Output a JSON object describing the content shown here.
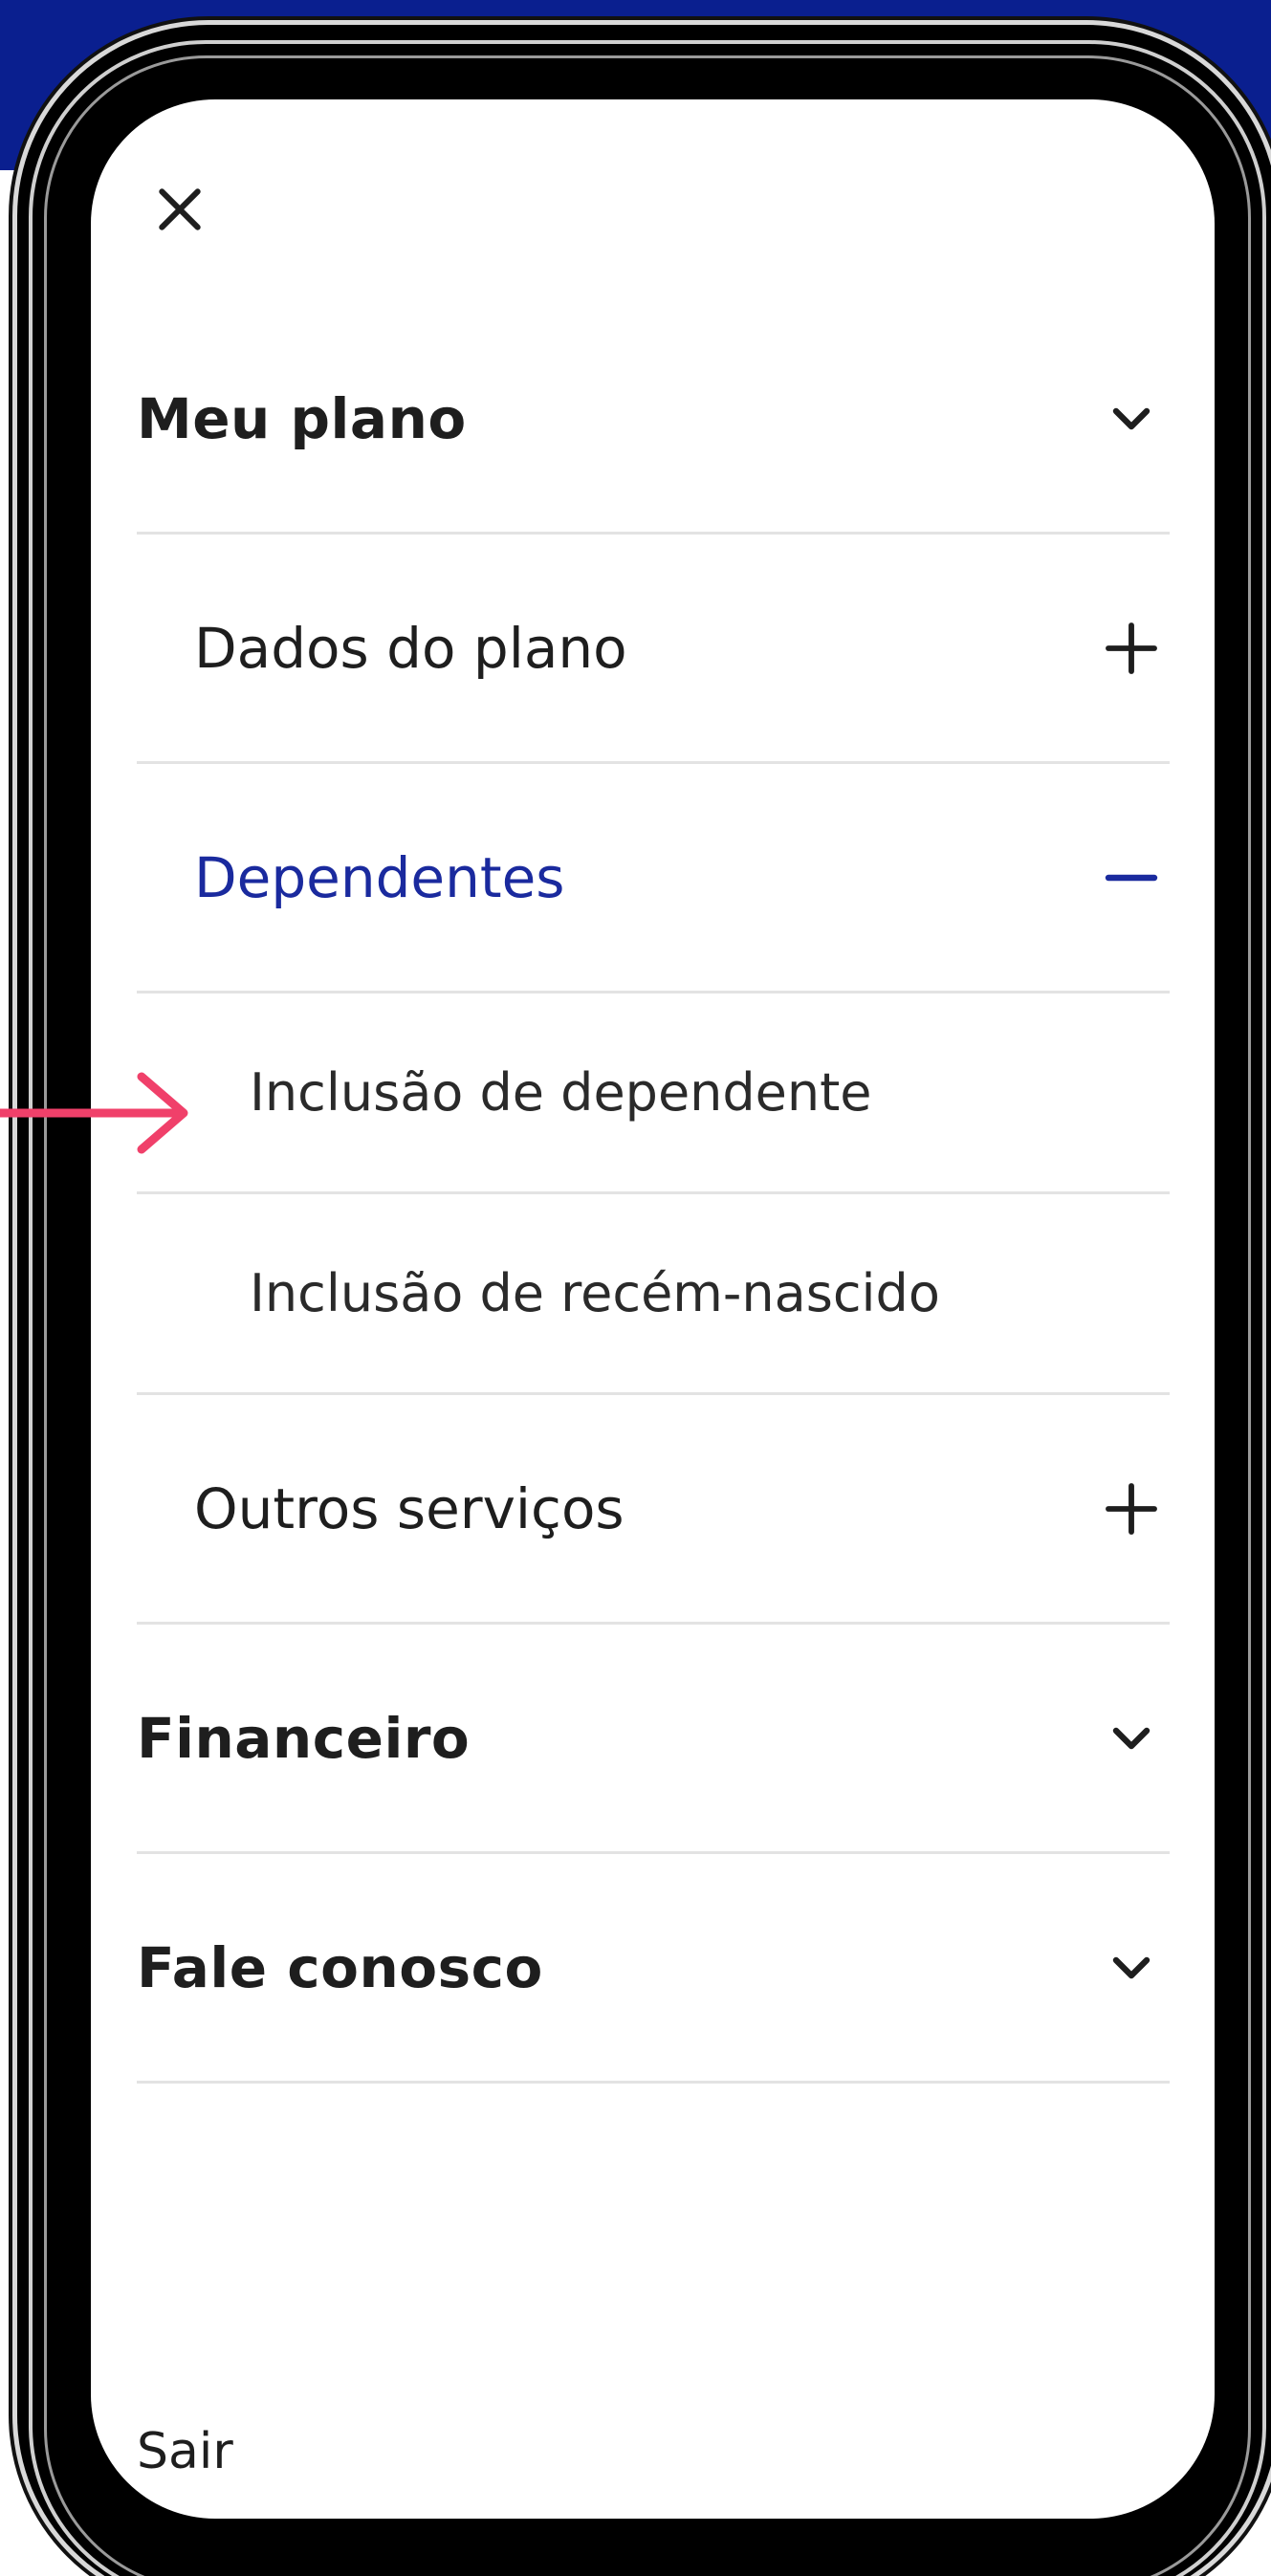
{
  "colors": {
    "brand_blue": "#0a1f8f",
    "active_text": "#1a2a9e",
    "pointer_arrow": "#f0406a"
  },
  "menu": {
    "close_icon": "close-icon",
    "items": [
      {
        "label": "Meu plano",
        "icon": "chevron-down-icon"
      },
      {
        "label": "Dados do plano",
        "icon": "plus-icon"
      },
      {
        "label": "Dependentes",
        "icon": "minus-icon"
      },
      {
        "label": "Inclusão de dependente"
      },
      {
        "label": "Inclusão de recém-nascido"
      },
      {
        "label": "Outros serviços",
        "icon": "plus-icon"
      },
      {
        "label": "Financeiro",
        "icon": "chevron-down-icon"
      },
      {
        "label": "Fale conosco",
        "icon": "chevron-down-icon"
      }
    ],
    "footer_link": "Sair"
  }
}
